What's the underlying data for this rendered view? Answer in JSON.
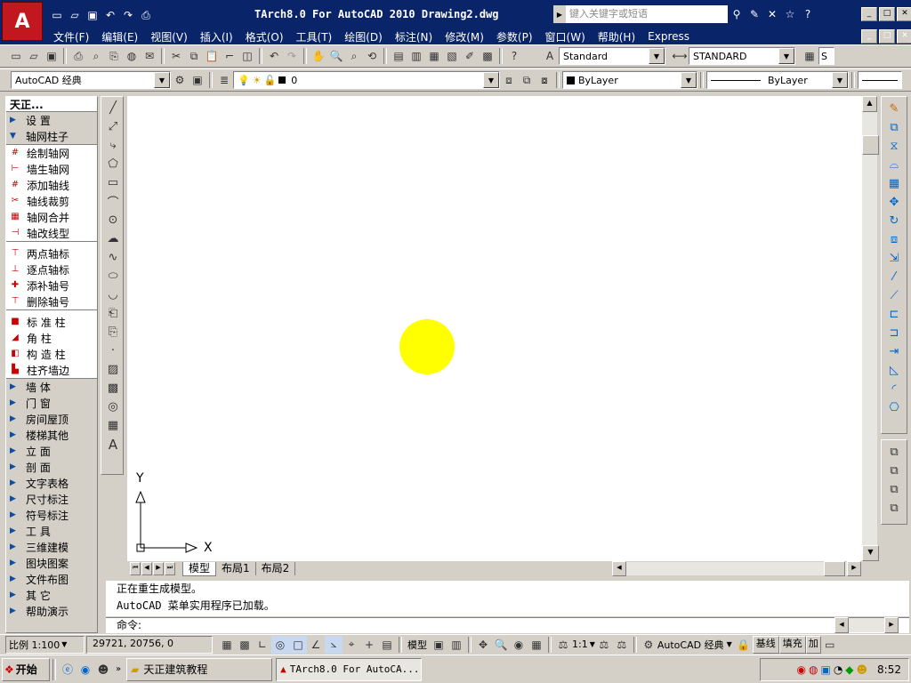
{
  "title_bar": {
    "title": "TArch8.0 For AutoCAD 2010  Drawing2.dwg",
    "search_placeholder": "键入关键字或短语"
  },
  "menu": [
    "文件(F)",
    "编辑(E)",
    "视图(V)",
    "插入(I)",
    "格式(O)",
    "工具(T)",
    "绘图(D)",
    "标注(N)",
    "修改(M)",
    "参数(P)",
    "窗口(W)",
    "帮助(H)",
    "Express"
  ],
  "toolbar2": {
    "text_style": "Standard",
    "dim_style": "STANDARD",
    "s_combo": "S"
  },
  "toolbar3": {
    "workspace": "AutoCAD 经典",
    "layer": "0",
    "color": "ByLayer",
    "linetype": "ByLayer"
  },
  "tianzheng": {
    "title": "天正...",
    "top_cats": [
      "设    置",
      "轴网柱子"
    ],
    "group1": [
      "绘制轴网",
      "墙生轴网",
      "添加轴线",
      "轴线裁剪",
      "轴网合并",
      "轴改线型"
    ],
    "group2": [
      "两点轴标",
      "逐点轴标",
      "添补轴号",
      "删除轴号"
    ],
    "group3": [
      "标 准 柱",
      "角    柱",
      "构 造 柱",
      "柱齐墙边"
    ],
    "bottom_cats": [
      "墙    体",
      "门    窗",
      "房间屋顶",
      "楼梯其他",
      "立    面",
      "剖    面",
      "文字表格",
      "尺寸标注",
      "符号标注",
      "工    具",
      "三维建模",
      "图块图案",
      "文件布图",
      "其    它",
      "帮助演示"
    ]
  },
  "ucs": {
    "x": "X",
    "y": "Y"
  },
  "tabs": [
    "模型",
    "布局1",
    "布局2"
  ],
  "command": {
    "line1": "正在重生成模型。",
    "line2": "AutoCAD 菜单实用程序已加载。",
    "prompt": "命令:"
  },
  "status": {
    "scale": "比例 1:100",
    "coords": "29721, 20756, 0",
    "model": "模型",
    "anno_scale": "1:1",
    "workspace": "AutoCAD 经典",
    "baseline": "基线",
    "fill": "填充",
    "add": "加"
  },
  "taskbar": {
    "start": "开始",
    "folder": "天正建筑教程",
    "app": "TArch8.0 For AutoCA...",
    "time": "8:52"
  },
  "colors": {
    "title_blue": "#0a246a",
    "autocad_red": "#c0181e",
    "circle": "#ffff00"
  }
}
